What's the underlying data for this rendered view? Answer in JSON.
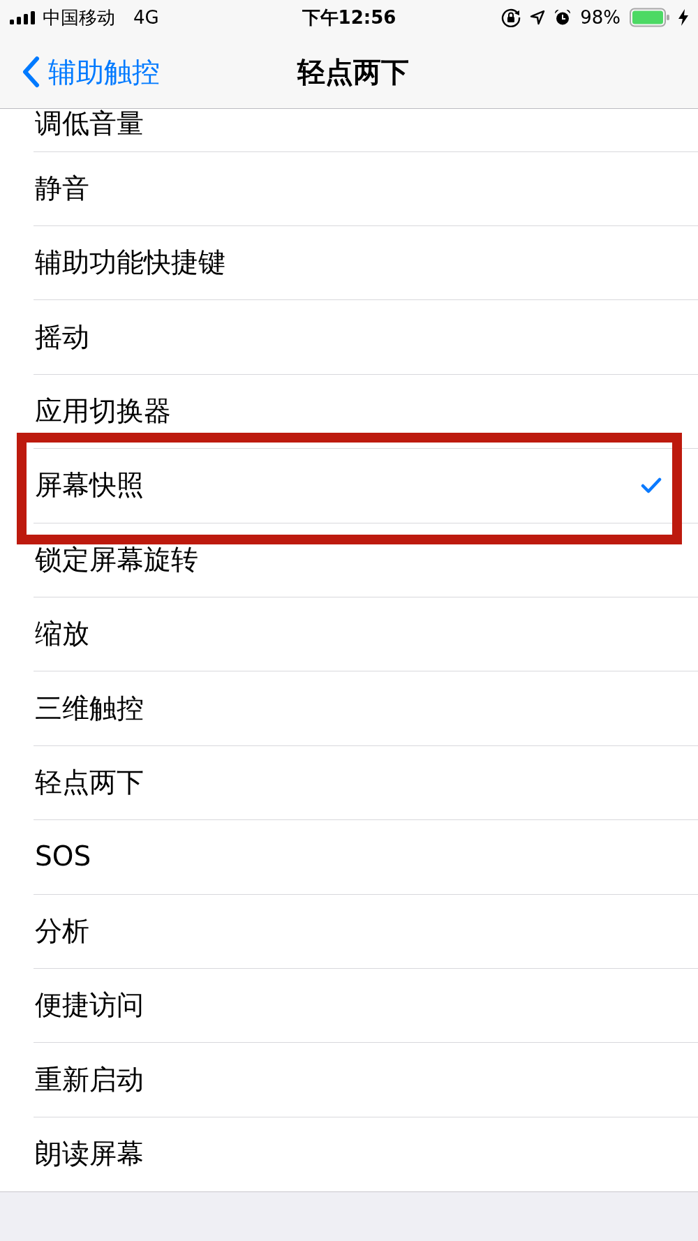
{
  "status_bar": {
    "carrier": "中国移动",
    "network": "4G",
    "time": "下午12:56",
    "battery_percent": "98%"
  },
  "nav_bar": {
    "back": "辅助触控",
    "title": "轻点两下"
  },
  "options": [
    {
      "label": "调低音量",
      "selected": false,
      "highlighted": false
    },
    {
      "label": "静音",
      "selected": false,
      "highlighted": false
    },
    {
      "label": "辅助功能快捷键",
      "selected": false,
      "highlighted": false
    },
    {
      "label": "摇动",
      "selected": false,
      "highlighted": false
    },
    {
      "label": "应用切换器",
      "selected": false,
      "highlighted": false
    },
    {
      "label": "屏幕快照",
      "selected": true,
      "highlighted": true
    },
    {
      "label": "锁定屏幕旋转",
      "selected": false,
      "highlighted": false
    },
    {
      "label": "缩放",
      "selected": false,
      "highlighted": false
    },
    {
      "label": "三维触控",
      "selected": false,
      "highlighted": false
    },
    {
      "label": "轻点两下",
      "selected": false,
      "highlighted": false
    },
    {
      "label": "SOS",
      "selected": false,
      "highlighted": false
    },
    {
      "label": "分析",
      "selected": false,
      "highlighted": false
    },
    {
      "label": "便捷访问",
      "selected": false,
      "highlighted": false
    },
    {
      "label": "重新启动",
      "selected": false,
      "highlighted": false
    },
    {
      "label": "朗读屏幕",
      "selected": false,
      "highlighted": false
    }
  ]
}
